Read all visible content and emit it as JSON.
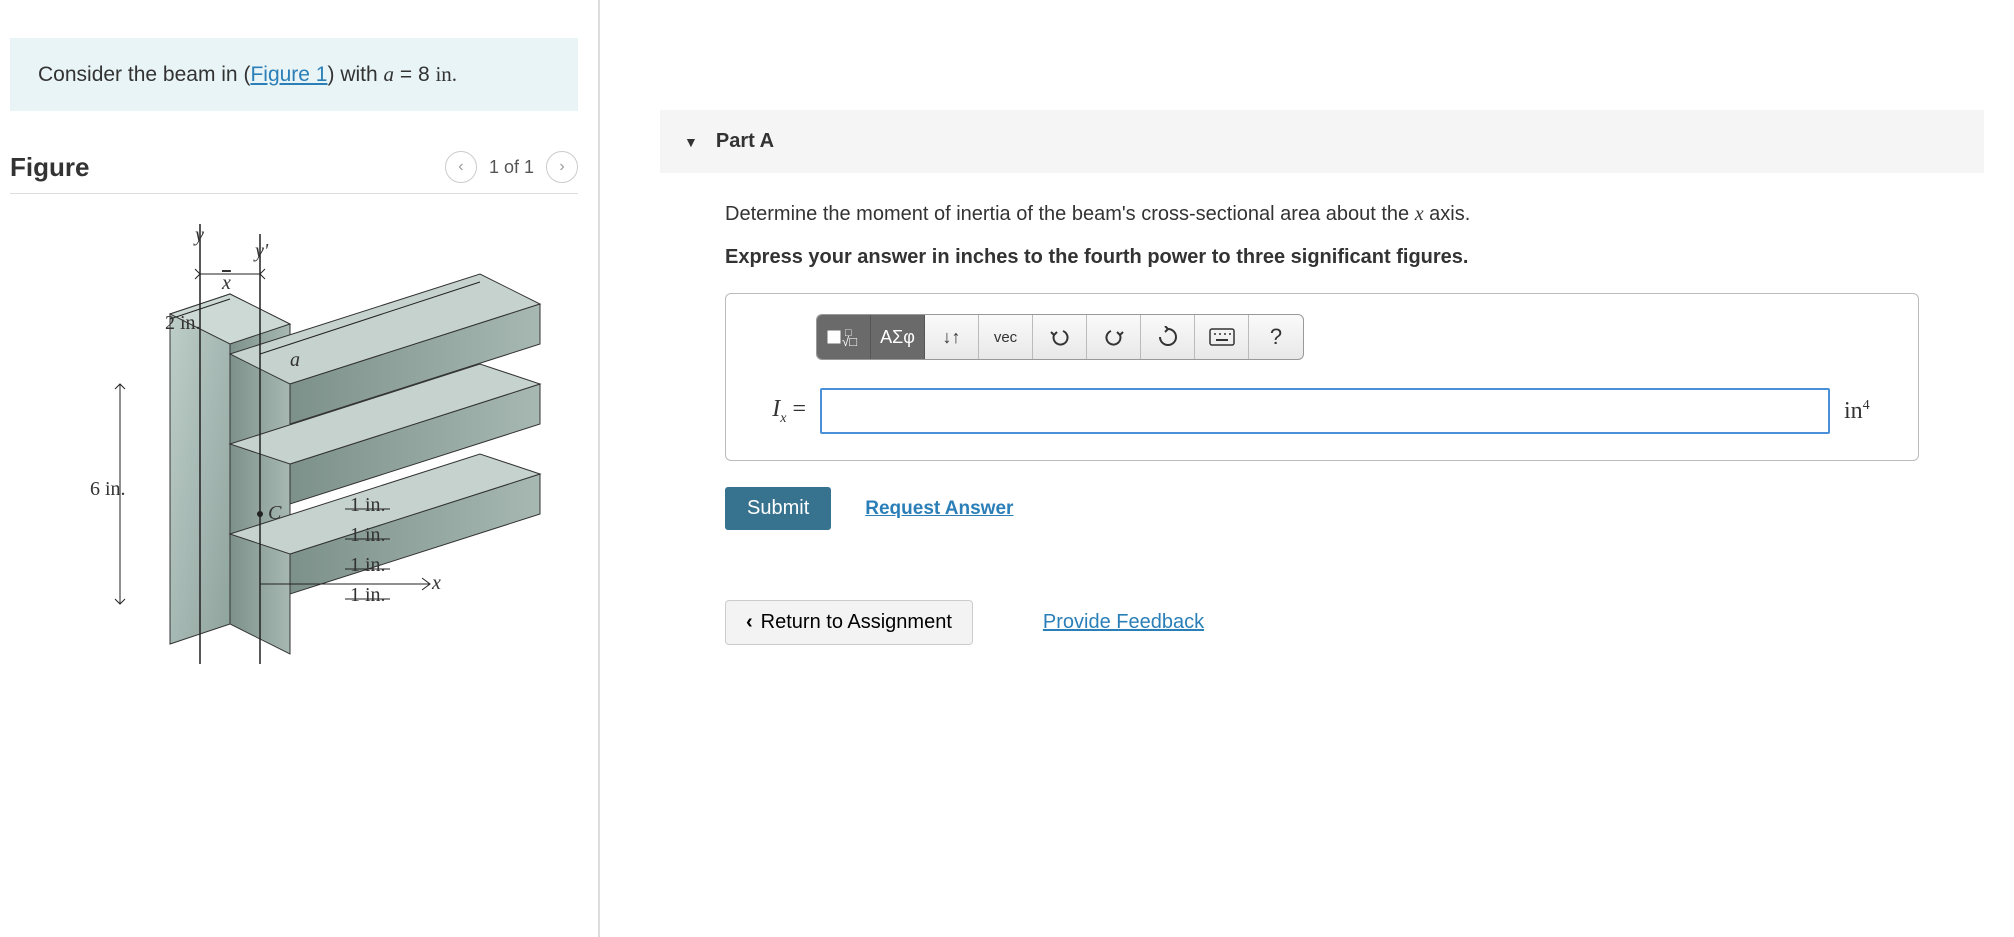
{
  "problem": {
    "pre": "Consider the beam in (",
    "link": "Figure 1",
    "post": ") with ",
    "var": "a",
    "eq": " = 8 ",
    "unit": "in."
  },
  "figure": {
    "title": "Figure",
    "count": "1 of 1",
    "labels": {
      "y": "y",
      "yprime": "y'",
      "xbar": "x",
      "two_in": "2 in.",
      "a": "a",
      "six_in": "6 in.",
      "C": "C",
      "one_in_1": "1 in.",
      "one_in_2": "1 in.",
      "one_in_3": "1 in.",
      "one_in_4": "1 in.",
      "x": "x"
    }
  },
  "part": {
    "title": "Part A",
    "prompt_pre": "Determine the moment of inertia of the beam's cross-sectional area about the ",
    "prompt_var": "x",
    "prompt_post": " axis.",
    "instructions": "Express your answer in inches to the fourth power to three significant figures.",
    "toolbar": {
      "templates": "templates",
      "greek": "ΑΣφ",
      "subscript": "↓↑",
      "vec": "vec",
      "undo": "undo",
      "redo": "redo",
      "reset": "reset",
      "keyboard": "keyboard",
      "help": "?"
    },
    "answer_label_var": "I",
    "answer_label_sub": "x",
    "answer_label_eq": " = ",
    "answer_value": "",
    "unit_base": "in",
    "unit_exp": "4",
    "submit": "Submit",
    "request": "Request Answer"
  },
  "bottom": {
    "return": "Return to Assignment",
    "feedback": "Provide Feedback"
  }
}
